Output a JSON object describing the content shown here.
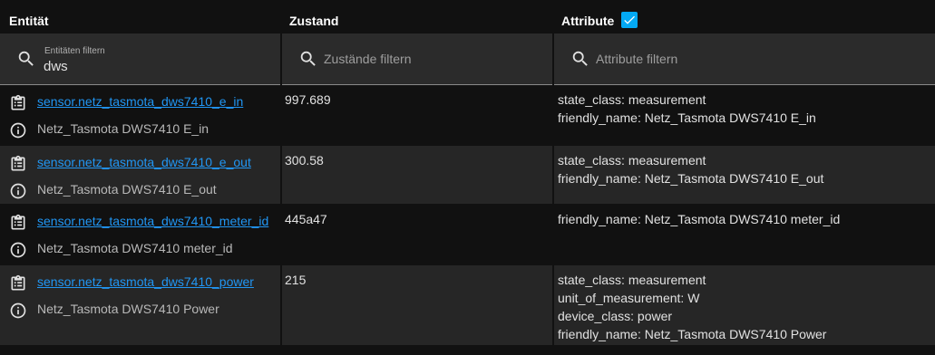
{
  "header": {
    "col_entity": "Entität",
    "col_state": "Zustand",
    "col_attributes": "Attribute"
  },
  "filters": {
    "entity_label": "Entitäten filtern",
    "entity_value": "dws",
    "state_placeholder": "Zustände filtern",
    "attributes_placeholder": "Attribute filtern"
  },
  "rows": [
    {
      "entity_id": "sensor.netz_tasmota_dws7410_e_in",
      "name": "Netz_Tasmota DWS7410 E_in",
      "state": "997.689",
      "attributes": [
        "state_class: measurement",
        "friendly_name: Netz_Tasmota DWS7410 E_in"
      ]
    },
    {
      "entity_id": "sensor.netz_tasmota_dws7410_e_out",
      "name": "Netz_Tasmota DWS7410 E_out",
      "state": "300.58",
      "attributes": [
        "state_class: measurement",
        "friendly_name: Netz_Tasmota DWS7410 E_out"
      ]
    },
    {
      "entity_id": "sensor.netz_tasmota_dws7410_meter_id",
      "name": "Netz_Tasmota DWS7410 meter_id",
      "state": "445a47",
      "attributes": [
        "friendly_name: Netz_Tasmota DWS7410 meter_id"
      ]
    },
    {
      "entity_id": "sensor.netz_tasmota_dws7410_power",
      "name": "Netz_Tasmota DWS7410 Power",
      "state": "215",
      "attributes": [
        "state_class: measurement",
        "unit_of_measurement: W",
        "device_class: power",
        "friendly_name: Netz_Tasmota DWS7410 Power"
      ]
    }
  ],
  "colors": {
    "background": "#111111",
    "alt_row": "#262626",
    "link": "#2196f3",
    "checkbox": "#03a9f4"
  },
  "icons": {
    "search": "magnify-icon",
    "entity": "clipboard-list-icon",
    "info": "information-outline-icon",
    "checkbox": "check-icon"
  }
}
